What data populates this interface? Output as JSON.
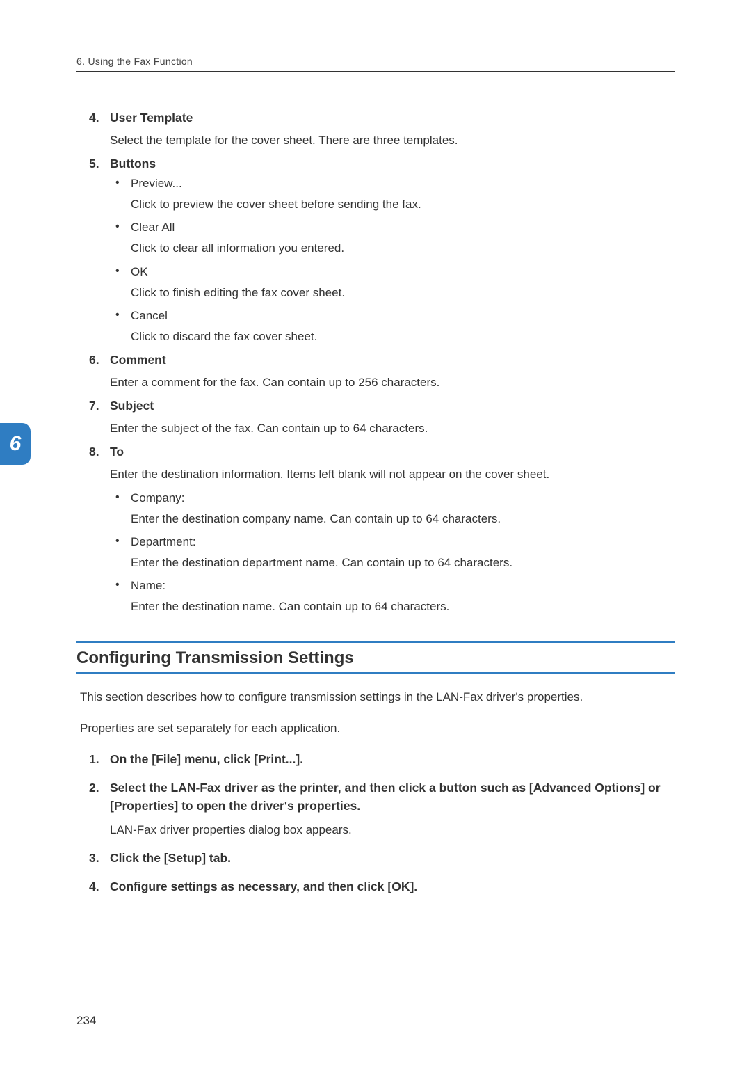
{
  "header": "6. Using the Fax Function",
  "chapterTab": "6",
  "items": [
    {
      "num": "4.",
      "title": "User Template",
      "desc": "Select the template for the cover sheet. There are three templates."
    },
    {
      "num": "5.",
      "title": "Buttons",
      "bullets": [
        {
          "label": "Preview...",
          "body": "Click to preview the cover sheet before sending the fax."
        },
        {
          "label": "Clear All",
          "body": "Click to clear all information you entered."
        },
        {
          "label": "OK",
          "body": "Click to finish editing the fax cover sheet."
        },
        {
          "label": "Cancel",
          "body": "Click to discard the fax cover sheet."
        }
      ]
    },
    {
      "num": "6.",
      "title": "Comment",
      "desc": "Enter a comment for the fax. Can contain up to 256 characters."
    },
    {
      "num": "7.",
      "title": "Subject",
      "desc": "Enter the subject of the fax. Can contain up to 64 characters."
    },
    {
      "num": "8.",
      "title": "To",
      "desc": "Enter the destination information. Items left blank will not appear on the cover sheet.",
      "bullets": [
        {
          "label": "Company:",
          "body": "Enter the destination company name. Can contain up to 64 characters."
        },
        {
          "label": "Department:",
          "body": "Enter the destination department name. Can contain up to 64 characters."
        },
        {
          "label": "Name:",
          "body": "Enter the destination name. Can contain up to 64 characters."
        }
      ]
    }
  ],
  "sectionHeading": "Configuring Transmission Settings",
  "sectionIntro1": "This section describes how to configure transmission settings in the LAN-Fax driver's properties.",
  "sectionIntro2": "Properties are set separately for each application.",
  "steps": [
    {
      "num": "1.",
      "title": "On the [File] menu, click [Print...]."
    },
    {
      "num": "2.",
      "title": "Select the LAN-Fax driver as the printer, and then click a button such as [Advanced Options] or [Properties] to open the driver's properties.",
      "body": "LAN-Fax driver properties dialog box appears."
    },
    {
      "num": "3.",
      "title": "Click the [Setup] tab."
    },
    {
      "num": "4.",
      "title": "Configure settings as necessary, and then click [OK]."
    }
  ],
  "pageNumber": "234"
}
